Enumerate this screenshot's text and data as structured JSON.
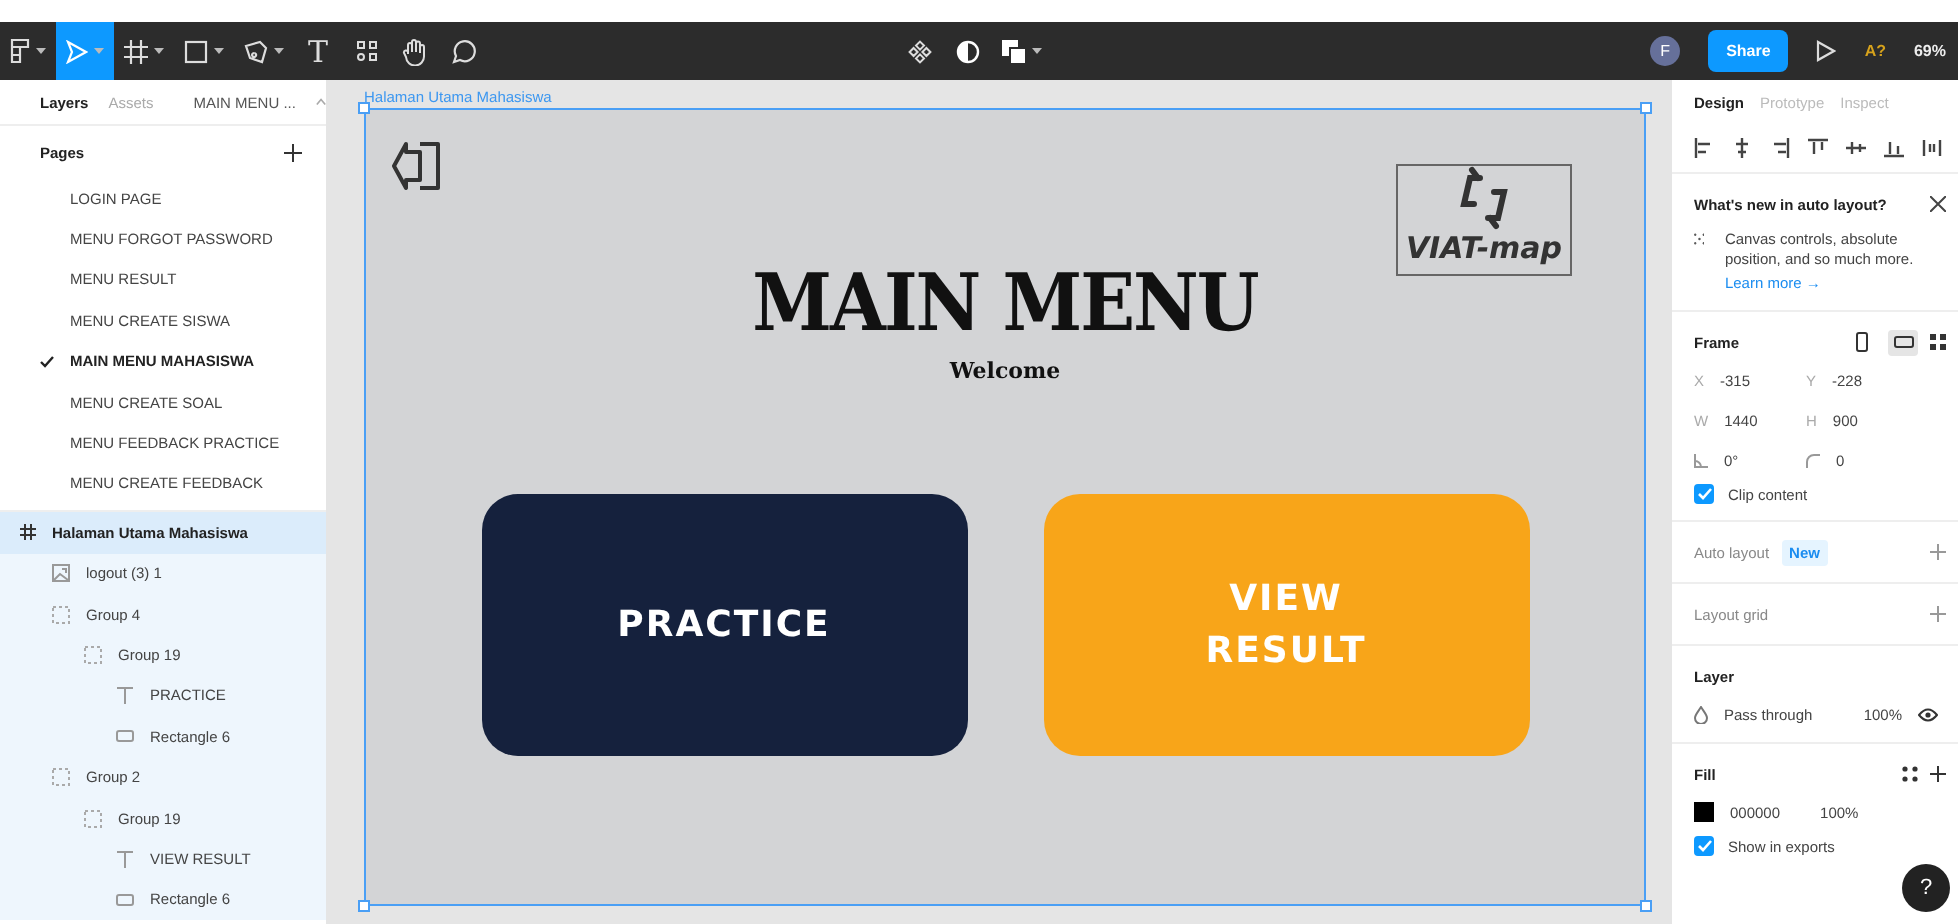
{
  "toolbar": {
    "tools": [
      {
        "kind": "figma-menu",
        "selected": false,
        "has_menu": true
      },
      {
        "kind": "move",
        "selected": true,
        "has_menu": true
      },
      {
        "kind": "frame",
        "selected": false,
        "has_menu": true
      },
      {
        "kind": "shape",
        "selected": false,
        "has_menu": true
      },
      {
        "kind": "pen",
        "selected": false,
        "has_menu": true
      },
      {
        "kind": "text",
        "glyph": "T",
        "selected": false,
        "has_menu": false
      },
      {
        "kind": "resources",
        "selected": false,
        "has_menu": false
      },
      {
        "kind": "hand",
        "selected": false,
        "has_menu": false
      },
      {
        "kind": "comment",
        "selected": false,
        "has_menu": false
      }
    ],
    "center_tools": [
      {
        "kind": "component",
        "has_menu": false
      },
      {
        "kind": "mask",
        "has_menu": false
      },
      {
        "kind": "boolean",
        "has_menu": true
      }
    ],
    "avatar": "F",
    "share": "Share",
    "badge": "A?",
    "zoom": "69%"
  },
  "left_panel": {
    "tabs": [
      {
        "label": "Layers",
        "selected": true
      },
      {
        "label": "Assets",
        "selected": false
      }
    ],
    "page_menu": "MAIN MENU ...",
    "pages_title": "Pages",
    "pages": [
      {
        "label": "LOGIN PAGE",
        "selected": false
      },
      {
        "label": "MENU FORGOT PASSWORD",
        "selected": false
      },
      {
        "label": "MENU RESULT",
        "selected": false
      },
      {
        "label": "MENU CREATE SISWA",
        "selected": false
      },
      {
        "label": "MAIN MENU MAHASISWA",
        "selected": true
      },
      {
        "label": "MENU CREATE SOAL",
        "selected": false
      },
      {
        "label": "MENU FEEDBACK PRACTICE",
        "selected": false
      },
      {
        "label": "MENU CREATE FEEDBACK",
        "selected": false
      }
    ],
    "layers": [
      {
        "name": "Halaman Utama Mahasiswa",
        "kind": "frame",
        "selected": true,
        "children": [
          {
            "name": "logout (3) 1",
            "kind": "image",
            "selected": false
          },
          {
            "name": "Group 4",
            "kind": "group",
            "selected": false,
            "children": [
              {
                "name": "Group 19",
                "kind": "group",
                "selected": false,
                "children": [
                  {
                    "name": "PRACTICE",
                    "kind": "text",
                    "selected": false
                  },
                  {
                    "name": "Rectangle 6",
                    "kind": "rectangle",
                    "selected": false
                  }
                ]
              }
            ]
          },
          {
            "name": "Group 2",
            "kind": "group",
            "selected": false,
            "children": [
              {
                "name": "Group 19",
                "kind": "group",
                "selected": false,
                "children": [
                  {
                    "name": "VIEW RESULT",
                    "kind": "text",
                    "selected": false
                  },
                  {
                    "name": "Rectangle 6",
                    "kind": "rectangle",
                    "selected": false
                  }
                ]
              }
            ]
          }
        ]
      }
    ]
  },
  "canvas": {
    "frame_label": "Halaman Utama Mahasiswa",
    "frame": {
      "logo_text": "VIAT-map",
      "title": "MAIN MENU",
      "subtitle": "Welcome",
      "buttons": [
        {
          "label": "PRACTICE",
          "color": "#15213d"
        },
        {
          "label": "VIEW RESULT",
          "color": "#f8a519"
        }
      ]
    }
  },
  "right_panel": {
    "tabs": [
      {
        "label": "Design",
        "selected": true
      },
      {
        "label": "Prototype",
        "selected": false
      },
      {
        "label": "Inspect",
        "selected": false
      }
    ],
    "whats_new": {
      "title": "What's new in auto layout?",
      "text": "Canvas controls, absolute position, and so much more.",
      "link": "Learn more →"
    },
    "frame": {
      "title": "Frame",
      "orientations": [
        {
          "kind": "portrait",
          "selected": false
        },
        {
          "kind": "landscape",
          "selected": true
        }
      ],
      "fields": [
        {
          "kind": "labeled",
          "label": "X",
          "value": "-315"
        },
        {
          "kind": "labeled",
          "label": "Y",
          "value": "-228"
        },
        {
          "kind": "labeled",
          "label": "W",
          "value": "1440"
        },
        {
          "kind": "labeled",
          "label": "H",
          "value": "900"
        },
        {
          "kind": "rotation",
          "value": "0°"
        },
        {
          "kind": "radius",
          "value": "0"
        }
      ],
      "clip_content": {
        "label": "Clip content",
        "checked": true
      }
    },
    "auto_layout": {
      "title": "Auto layout",
      "badge": "New"
    },
    "layout_grid": {
      "title": "Layout grid"
    },
    "layer": {
      "title": "Layer",
      "blend": "Pass through",
      "opacity": "100%"
    },
    "fill": {
      "title": "Fill",
      "hex": "000000",
      "opacity": "100%",
      "show_in_exports": {
        "label": "Show in exports",
        "checked": true
      }
    },
    "help": "?"
  }
}
